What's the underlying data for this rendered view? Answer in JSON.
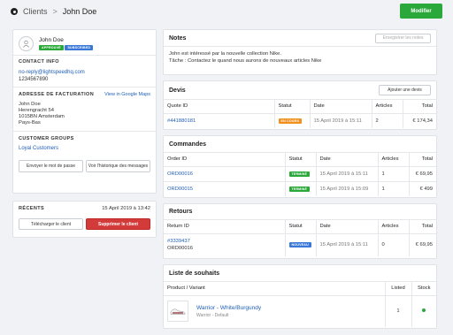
{
  "header": {
    "breadcrumb_root": "Clients",
    "breadcrumb_sep": ">",
    "breadcrumb_current": "John Doe",
    "primary_button": "Modifier"
  },
  "customer": {
    "name": "John Doe",
    "badges": [
      "APPROUVÉ",
      "SUBSCRIBED"
    ],
    "contact_title": "CONTACT INFO",
    "email": "no-reply@lightspeedhq.com",
    "phone": "1234567890",
    "billing_title": "ADRESSE DE FACTURATION",
    "maps_link": "View in Google Maps",
    "address": [
      "John Doe",
      "Herengracht 54",
      "1015BN Amsterdam",
      "Pays-Bas"
    ],
    "groups_title": "CUSTOMER GROUPS",
    "group": "Loyal Customers",
    "btn_reset": "Envoyer le mot de passe",
    "btn_history": "Voir l'historique des messages"
  },
  "recent": {
    "title": "RÉCENTS",
    "date": "15 April 2019 à 13:42",
    "btn_download": "Télécharger le client",
    "btn_delete": "Supprimer le client"
  },
  "notes": {
    "title": "Notes",
    "save_button": "Enregistrer les notes",
    "line1": "John est intéressé par la nouvelle collection Nike.",
    "line2": "Tâche : Contactez le quand nous aurons de nouveaux articles Nike"
  },
  "quotes": {
    "title": "Devis",
    "add_button": "Ajouter une devis",
    "headers": [
      "Quote ID",
      "Statut",
      "Date",
      "Articles",
      "Total"
    ],
    "rows": [
      {
        "id": "#441880181",
        "status": "EN COURS",
        "date": "15 April 2019 à 15:11",
        "items": "2",
        "total": "€ 174,34"
      }
    ]
  },
  "orders": {
    "title": "Commandes",
    "headers": [
      "Order ID",
      "Statut",
      "Date",
      "Articles",
      "Total"
    ],
    "rows": [
      {
        "id": "ORD00016",
        "status": "TERMINÉ",
        "date": "15 April 2019 à 15:11",
        "items": "1",
        "total": "€ 69,95"
      },
      {
        "id": "ORD00015",
        "status": "TERMINÉ",
        "date": "15 April 2019 à 15:09",
        "items": "1",
        "total": "€ 499"
      }
    ]
  },
  "returns": {
    "title": "Retours",
    "headers": [
      "Return ID",
      "Statut",
      "Date",
      "Articles",
      "Total"
    ],
    "rows": [
      {
        "id": "#3339437",
        "sub": "ORD00016",
        "status": "NOUVEAU",
        "date": "15 April 2019 à 15:11",
        "items": "0",
        "total": "€ 69,95"
      }
    ]
  },
  "wishlist": {
    "title": "Liste de souhaits",
    "headers": [
      "Product / Variant",
      "Listed",
      "Stock"
    ],
    "rows": [
      {
        "name": "Warrior - White/Burgundy",
        "variant": "Warrior - Default",
        "listed": "1"
      }
    ]
  },
  "colors": {
    "green": "#2aa83a",
    "orange": "#f0901e",
    "blue": "#3a78d8",
    "red": "#d33a3a",
    "link": "#2060b8"
  }
}
